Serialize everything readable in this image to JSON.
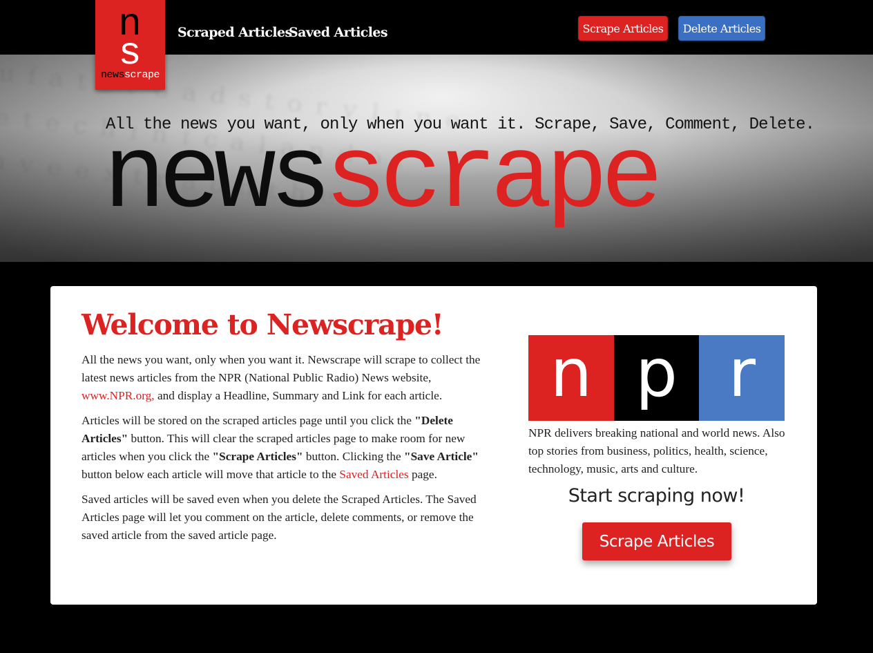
{
  "logo": {
    "mark": "ns",
    "text_part1": "news",
    "text_part2": "scrape"
  },
  "nav": {
    "links": [
      "Scraped Articles",
      "Saved Articles"
    ],
    "scrape_button": "Scrape Articles",
    "delete_button": "Delete Articles"
  },
  "hero": {
    "tagline": "All the news you want, only when you want it. Scrape, Save, Comment, Delete.",
    "title_part1": "news",
    "title_part2": "scrape"
  },
  "main": {
    "heading": "Welcome to Newscrape!",
    "p1_before_link": "All the news you want, only when you want it. Newscrape will scrape to collect the latest news articles from the NPR (National Public Radio) News website, ",
    "p1_link": "www.NPR.org,",
    "p1_after_link": " and display a Headline, Summary and Link for each article.",
    "p2_a": "Articles will be stored on the scraped articles page until you click the ",
    "p2_b": "\"Delete Articles\"",
    "p2_c": " button. This will clear the scraped articles page to make room for new articles when you click the ",
    "p2_d": "\"Scrape Articles\"",
    "p2_e": " button. Clicking the ",
    "p2_f": "\"Save Article\"",
    "p2_g": " button below each article will move that article to the ",
    "p2_link": "Saved Articles",
    "p2_h": " page.",
    "p3": "Saved articles will be saved even when you delete the Scraped Articles. The Saved Articles page will let you comment on the article, delete comments, or remove the saved article from the saved article page."
  },
  "npr": {
    "letters": [
      "n",
      "p",
      "r"
    ],
    "description": "NPR delivers breaking national and world news. Also top stories from business, politics, health, science, technology, music, arts and culture.",
    "cta_heading": "Start scraping now!",
    "cta_button": "Scrape Articles"
  },
  "colors": {
    "brand_red": "#dd2222",
    "blue": "#3b6fc2",
    "black": "#000000"
  }
}
